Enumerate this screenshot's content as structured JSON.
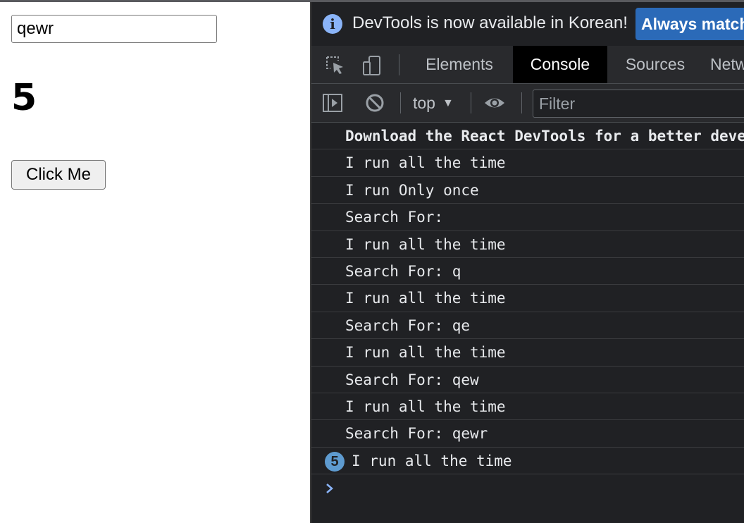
{
  "page": {
    "search_value": "qewr",
    "counter": "5",
    "button_label": "Click Me"
  },
  "devtools": {
    "infobar": {
      "message": "DevTools is now available in Korean!",
      "action_label": "Always match"
    },
    "tabs": [
      {
        "label": "Elements",
        "active": false
      },
      {
        "label": "Console",
        "active": true
      },
      {
        "label": "Sources",
        "active": false
      },
      {
        "label": "Network",
        "active": false
      }
    ],
    "toolbar": {
      "context": "top",
      "filter_placeholder": "Filter"
    },
    "console": {
      "messages": [
        {
          "text": "Download the React DevTools for a better development experience",
          "bold": true
        },
        {
          "text": "I run all the time"
        },
        {
          "text": "I run Only once"
        },
        {
          "text": "Search For:"
        },
        {
          "text": "I run all the time"
        },
        {
          "text": "Search For: q"
        },
        {
          "text": "I run all the time"
        },
        {
          "text": "Search For: qe"
        },
        {
          "text": "I run all the time"
        },
        {
          "text": "Search For: qew"
        },
        {
          "text": "I run all the time"
        },
        {
          "text": "Search For: qewr"
        },
        {
          "text": "I run all the time",
          "repeat": "5"
        }
      ]
    },
    "colors": {
      "background": "#202124",
      "toolbar": "#292a2d",
      "active_tab": "#000000",
      "accent": "#8ab4f8",
      "badge": "#5e9bd0",
      "action_button": "#2b6ab8"
    }
  }
}
